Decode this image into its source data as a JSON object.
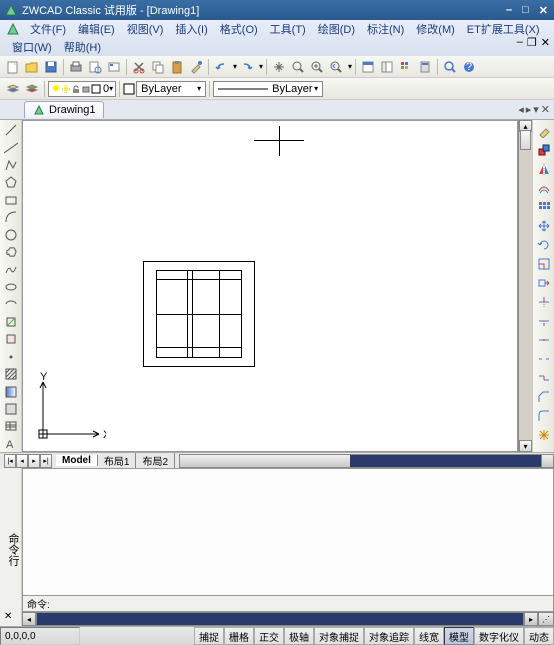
{
  "titlebar": {
    "app_name": "ZWCAD Classic 试用版",
    "doc_name": "[Drawing1]"
  },
  "menu": {
    "file": "文件(F)",
    "edit": "编辑(E)",
    "view": "视图(V)",
    "insert": "插入(I)",
    "format": "格式(O)",
    "tools": "工具(T)",
    "draw": "绘图(D)",
    "dimension": "标注(N)",
    "modify": "修改(M)",
    "ettools": "ET扩展工具(X)",
    "window": "窗口(W)",
    "help": "帮助(H)"
  },
  "layer": {
    "zero": "0"
  },
  "props": {
    "bylayer1": "ByLayer",
    "bylayer2": "ByLayer"
  },
  "doctab": {
    "name": "Drawing1"
  },
  "ucs": {
    "x": "X",
    "y": "Y"
  },
  "modeltabs": {
    "model": "Model",
    "layout1": "布局1",
    "layout2": "布局2"
  },
  "cmd": {
    "side": "命令行",
    "prompt": "命令:"
  },
  "status": {
    "coord": "0,0,0,0",
    "snap": "捕捉",
    "grid": "栅格",
    "ortho": "正交",
    "polar": "极轴",
    "osnap": "对象捕捉",
    "otrack": "对象追踪",
    "lwt": "线宽",
    "model": "模型",
    "digitizer": "数字化仪",
    "dyn": "动态"
  }
}
